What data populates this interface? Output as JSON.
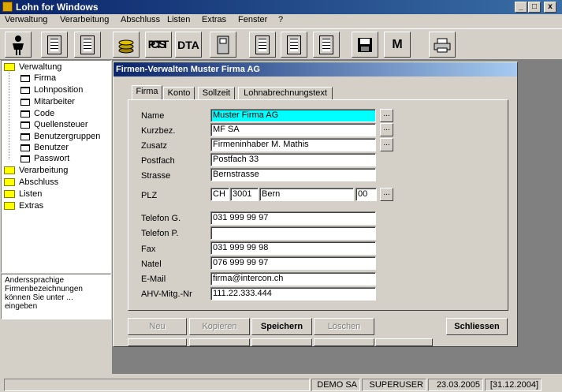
{
  "app": {
    "title": "Lohn for Windows"
  },
  "window_controls": {
    "minimize": "_",
    "maximize": "□",
    "close": "x"
  },
  "menu": [
    "Verwaltung",
    "Verarbeitung",
    "Abschluss",
    "Listen",
    "Extras",
    "Fenster",
    "?"
  ],
  "toolbar": {
    "cs_top": "CS",
    "cs_bottom": "PTT",
    "dta": "DTA",
    "m": "M",
    "doc_f": "F",
    "doc_k": "K"
  },
  "tree": {
    "root": "Verwaltung",
    "children": [
      "Firma",
      "Lohnposition",
      "Mitarbeiter",
      "Code",
      "Quellensteuer",
      "Benutzergruppen",
      "Benutzer",
      "Passwort"
    ],
    "others": [
      "Verarbeitung",
      "Abschluss",
      "Listen",
      "Extras"
    ]
  },
  "help_text": "Anderssprachige Firmenbezeichnungen können Sie unter ... eingeben",
  "subwindow": {
    "title": "Firmen-Verwalten Muster Firma AG"
  },
  "tabs": [
    "Firma",
    "Konto",
    "Sollzeit",
    "Lohnabrechnungstext"
  ],
  "form": {
    "name_label": "Name",
    "name": "Muster Firma AG",
    "kurzbez_label": "Kurzbez.",
    "kurzbez": "MF SA",
    "zusatz_label": "Zusatz",
    "zusatz": "Firmeninhaber M. Mathis",
    "postfach_label": "Postfach",
    "postfach": "Postfach 33",
    "strasse_label": "Strasse",
    "strasse": "Bernstrasse",
    "plz_label": "PLZ",
    "land": "CH",
    "plz": "3001",
    "ort": "Bern",
    "plz_extra": "00",
    "telefon_g_label": "Telefon G.",
    "telefon_g": "031 999 99 97",
    "telefon_p_label": "Telefon P.",
    "telefon_p": "",
    "fax_label": "Fax",
    "fax": "031 999 99 98",
    "natel_label": "Natel",
    "natel": "076 999 99 97",
    "email_label": "E-Mail",
    "email": "firma@intercon.ch",
    "ahv_label": "AHV-Mitg.-Nr",
    "ahv": "111.22.333.444",
    "dots": "..."
  },
  "buttons": {
    "neu": "Neu",
    "kopieren": "Kopieren",
    "speichern": "Speichern",
    "loeschen": "Löschen",
    "schliessen": "Schliessen"
  },
  "status": {
    "company": "DEMO SA",
    "user": "SUPERUSER",
    "date": "23.03.2005",
    "period_end": "[31.12.2004]"
  }
}
